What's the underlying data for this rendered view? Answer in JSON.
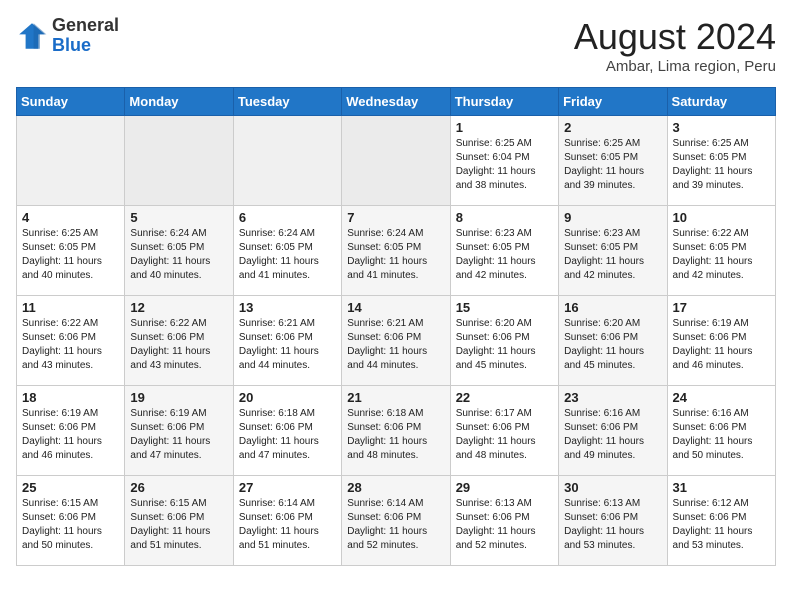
{
  "header": {
    "logo_general": "General",
    "logo_blue": "Blue",
    "month": "August 2024",
    "location": "Ambar, Lima region, Peru"
  },
  "weekdays": [
    "Sunday",
    "Monday",
    "Tuesday",
    "Wednesday",
    "Thursday",
    "Friday",
    "Saturday"
  ],
  "weeks": [
    [
      {
        "day": "",
        "empty": true
      },
      {
        "day": "",
        "empty": true
      },
      {
        "day": "",
        "empty": true
      },
      {
        "day": "",
        "empty": true
      },
      {
        "day": "1",
        "sunrise": "6:25 AM",
        "sunset": "6:04 PM",
        "daylight": "11 hours and 38 minutes."
      },
      {
        "day": "2",
        "sunrise": "6:25 AM",
        "sunset": "6:05 PM",
        "daylight": "11 hours and 39 minutes."
      },
      {
        "day": "3",
        "sunrise": "6:25 AM",
        "sunset": "6:05 PM",
        "daylight": "11 hours and 39 minutes."
      }
    ],
    [
      {
        "day": "4",
        "sunrise": "6:25 AM",
        "sunset": "6:05 PM",
        "daylight": "11 hours and 40 minutes."
      },
      {
        "day": "5",
        "sunrise": "6:24 AM",
        "sunset": "6:05 PM",
        "daylight": "11 hours and 40 minutes."
      },
      {
        "day": "6",
        "sunrise": "6:24 AM",
        "sunset": "6:05 PM",
        "daylight": "11 hours and 41 minutes."
      },
      {
        "day": "7",
        "sunrise": "6:24 AM",
        "sunset": "6:05 PM",
        "daylight": "11 hours and 41 minutes."
      },
      {
        "day": "8",
        "sunrise": "6:23 AM",
        "sunset": "6:05 PM",
        "daylight": "11 hours and 42 minutes."
      },
      {
        "day": "9",
        "sunrise": "6:23 AM",
        "sunset": "6:05 PM",
        "daylight": "11 hours and 42 minutes."
      },
      {
        "day": "10",
        "sunrise": "6:22 AM",
        "sunset": "6:05 PM",
        "daylight": "11 hours and 42 minutes."
      }
    ],
    [
      {
        "day": "11",
        "sunrise": "6:22 AM",
        "sunset": "6:06 PM",
        "daylight": "11 hours and 43 minutes."
      },
      {
        "day": "12",
        "sunrise": "6:22 AM",
        "sunset": "6:06 PM",
        "daylight": "11 hours and 43 minutes."
      },
      {
        "day": "13",
        "sunrise": "6:21 AM",
        "sunset": "6:06 PM",
        "daylight": "11 hours and 44 minutes."
      },
      {
        "day": "14",
        "sunrise": "6:21 AM",
        "sunset": "6:06 PM",
        "daylight": "11 hours and 44 minutes."
      },
      {
        "day": "15",
        "sunrise": "6:20 AM",
        "sunset": "6:06 PM",
        "daylight": "11 hours and 45 minutes."
      },
      {
        "day": "16",
        "sunrise": "6:20 AM",
        "sunset": "6:06 PM",
        "daylight": "11 hours and 45 minutes."
      },
      {
        "day": "17",
        "sunrise": "6:19 AM",
        "sunset": "6:06 PM",
        "daylight": "11 hours and 46 minutes."
      }
    ],
    [
      {
        "day": "18",
        "sunrise": "6:19 AM",
        "sunset": "6:06 PM",
        "daylight": "11 hours and 46 minutes."
      },
      {
        "day": "19",
        "sunrise": "6:19 AM",
        "sunset": "6:06 PM",
        "daylight": "11 hours and 47 minutes."
      },
      {
        "day": "20",
        "sunrise": "6:18 AM",
        "sunset": "6:06 PM",
        "daylight": "11 hours and 47 minutes."
      },
      {
        "day": "21",
        "sunrise": "6:18 AM",
        "sunset": "6:06 PM",
        "daylight": "11 hours and 48 minutes."
      },
      {
        "day": "22",
        "sunrise": "6:17 AM",
        "sunset": "6:06 PM",
        "daylight": "11 hours and 48 minutes."
      },
      {
        "day": "23",
        "sunrise": "6:16 AM",
        "sunset": "6:06 PM",
        "daylight": "11 hours and 49 minutes."
      },
      {
        "day": "24",
        "sunrise": "6:16 AM",
        "sunset": "6:06 PM",
        "daylight": "11 hours and 50 minutes."
      }
    ],
    [
      {
        "day": "25",
        "sunrise": "6:15 AM",
        "sunset": "6:06 PM",
        "daylight": "11 hours and 50 minutes."
      },
      {
        "day": "26",
        "sunrise": "6:15 AM",
        "sunset": "6:06 PM",
        "daylight": "11 hours and 51 minutes."
      },
      {
        "day": "27",
        "sunrise": "6:14 AM",
        "sunset": "6:06 PM",
        "daylight": "11 hours and 51 minutes."
      },
      {
        "day": "28",
        "sunrise": "6:14 AM",
        "sunset": "6:06 PM",
        "daylight": "11 hours and 52 minutes."
      },
      {
        "day": "29",
        "sunrise": "6:13 AM",
        "sunset": "6:06 PM",
        "daylight": "11 hours and 52 minutes."
      },
      {
        "day": "30",
        "sunrise": "6:13 AM",
        "sunset": "6:06 PM",
        "daylight": "11 hours and 53 minutes."
      },
      {
        "day": "31",
        "sunrise": "6:12 AM",
        "sunset": "6:06 PM",
        "daylight": "11 hours and 53 minutes."
      }
    ]
  ]
}
